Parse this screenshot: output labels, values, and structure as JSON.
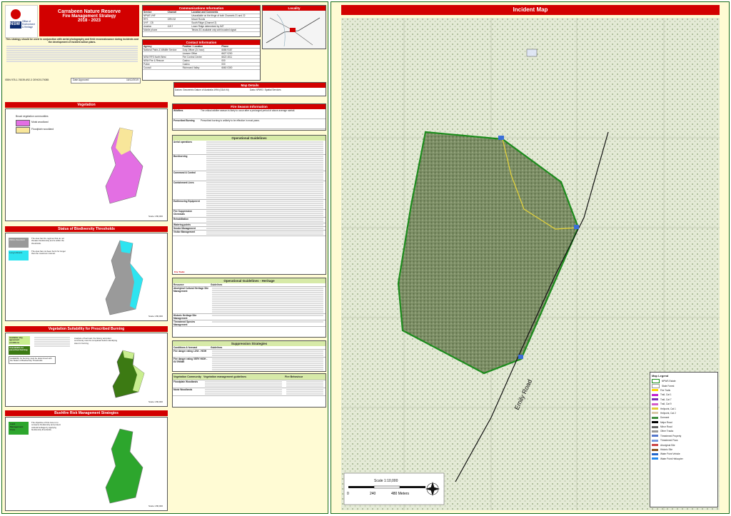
{
  "header": {
    "title": "Carrabeen Nature Reserve",
    "subtitle": "Fire Management Strategy",
    "years": "2018 - 2023",
    "logo_text": "Office of Environment & Heritage",
    "nsw": "NSW",
    "intro": "This strategy should be used in conjunction with aerial photography and field reconnaissance during incidents and the development of incident action plans.",
    "isbn": "ISBN 978-1-76039-692-3 OEH20170085",
    "date_label": "Date Approved",
    "date_value": "16/12/2019"
  },
  "communications": {
    "title": "Communications Information",
    "cols": [
      "Service",
      "Channel",
      "Location and Comments"
    ],
    "rows": [
      [
        "NPWS VHF",
        "",
        "Unavailable on the fringe of both Channels 21 and 22"
      ],
      [
        "RFS",
        "GRN 52",
        "Mount Runds"
      ],
      [
        "UHF - CB",
        "",
        "South Ridge (Channel 2)"
      ],
      [
        "Aviation",
        "119.7",
        "Lower Ridge determined by IMT"
      ],
      [
        "Mobile phone",
        "",
        "Telstra 3G available only with boosted signal"
      ]
    ]
  },
  "locality": {
    "title": "Locality"
  },
  "contacts": {
    "title": "Contact Information",
    "cols": [
      "Agency",
      "Position / Location",
      "Phone"
    ],
    "rows": [
      [
        "National Parks & Wildlife Service",
        "Duty Officer (24 hour)",
        "6686 9187"
      ],
      [
        "",
        "Lismore Office",
        "6627 0200"
      ],
      [
        "NSW RFS North West",
        "Fire Control Centre",
        "6622 4011"
      ],
      [
        "NSW Fire & Rescue",
        "Casino",
        "000"
      ],
      [
        "Police",
        "Casino",
        "000"
      ],
      [
        "Council",
        "Richmond Valley",
        "6660 0300"
      ]
    ]
  },
  "map_details": {
    "title": "Map Details",
    "left": "Datum: Geocentric Datum of Australia 1994 (GDA 94)",
    "right": "Data: NPWS / Spatial Services"
  },
  "vegetation": {
    "title": "Vegetation",
    "legend_title": "Broad vegetation communities",
    "items": [
      {
        "label": "Moist woodland",
        "color": "#e36fe3"
      },
      {
        "label": "Floodplain woodland",
        "color": "#f8e69a"
      }
    ],
    "scale": "Scale 1:80,000"
  },
  "biodiversity": {
    "title": "Status of Biodiversity Thresholds",
    "items": [
      {
        "label": "Within threshold",
        "color": "#9a9a9a",
        "desc": "The area has fire regimes that do not threaten biodiversity and is within the thresholds."
      },
      {
        "label": "Long Unburnt",
        "color": "#2ee4f0",
        "desc": "The area has not been burnt for longer than the maximum interval."
      }
    ],
    "scale": "Scale 1:80,000"
  },
  "suitability": {
    "title": "Vegetation Suitability for Prescribed Burning",
    "items": [
      {
        "label": "Available only, agreement conditions",
        "color": "#c9ee8f"
      },
      {
        "label": "Unavailable for prescribed burning",
        "color": "#3c7a13"
      },
      {
        "label": "Availability for burning must be determined with the Status of Biodiversity Thresholds",
        "color": "#ffffff"
      }
    ],
    "note": "Analysis of fuel load, fire history and plant community must be completed before identifying sites for burning.",
    "scale": "Scale 1:80,000"
  },
  "bushfire_risk": {
    "title": "Bushfire Risk Management Strategies",
    "item_label": "Land Management Zone",
    "item_color": "#2da62d",
    "desc": "The objective of this zone is to conserve biodiversity and protect cultural heritage by applying biodiversity thresholds.",
    "scale": "Scale 1:80,000"
  },
  "fire_season": {
    "title": "Fire Season Information",
    "rows": [
      {
        "label": "Wildfires",
        "text": "The critical wildfire season is likely to occur after a prolonged period of above average rainfall."
      },
      {
        "label": "Prescribed Burning",
        "text": "Prescribed burning is unlikely to be effective in most years."
      }
    ]
  },
  "operational": {
    "title": "Operational Guidelines",
    "rows": [
      {
        "label": "Aerial operations",
        "lines": 6
      },
      {
        "label": "Backburning",
        "lines": 7
      },
      {
        "label": "Command & Control",
        "lines": 4
      },
      {
        "label": "Containment Lines",
        "lines": 8
      },
      {
        "label": "Earthmoving Equipment",
        "lines": 4
      },
      {
        "label": "Fire Suppression Chemicals",
        "lines": 3
      },
      {
        "label": "Rehabilitation",
        "lines": 2
      },
      {
        "label": "Watering points",
        "lines": 1
      },
      {
        "label": "Smoke Management",
        "lines": 1
      },
      {
        "label": "Visitor Management",
        "lines": 2
      }
    ],
    "footer_label": "Fire Trails:"
  },
  "heritage": {
    "title": "Operational Guidelines - Heritage",
    "cols": [
      "Resource",
      "Guidelines"
    ],
    "rows": [
      {
        "label": "Aboriginal Cultural Heritage Site Management",
        "lines": 12
      },
      {
        "label": "Historic Heritage Site Management",
        "lines": 1
      },
      {
        "label": "Threatened Species Management",
        "lines": 1
      }
    ]
  },
  "suppression": {
    "title": "Suppression Strategies",
    "cols": [
      "Conditions & forecast",
      "Guidelines"
    ],
    "rows": [
      {
        "label": "Fire danger rating LOW - HIGH",
        "lines": 3
      },
      {
        "label": "Fire danger rating VERY HIGH - EXTREME",
        "lines": 6
      },
      {
        "label": "Catastrophic",
        "lines": 1
      }
    ]
  },
  "veg_management": {
    "cols": [
      "Vegetation Community",
      "Vegetation management guidelines",
      "Fire Behaviour"
    ],
    "rows": [
      {
        "label": "Floodplain Woodlands",
        "lines": 3
      },
      {
        "label": "Moist Woodlands",
        "lines": 3
      }
    ]
  },
  "incident_map": {
    "title": "Incident Map",
    "road_label": "Emily Road",
    "scale_text": "Scale 1:10,000",
    "scale_ticks": [
      "0",
      "240",
      "480 Meters"
    ],
    "legend": {
      "title": "Map Legend",
      "items": [
        {
          "label": "NPWS Estate",
          "color": "#ffffff",
          "border": "#1a8c1a"
        },
        {
          "label": "State Forest",
          "color": "#ffffff",
          "border": "#999999"
        },
        {
          "label": "Fire Trails",
          "color": "#ffd500"
        },
        {
          "label": "Trail, Cat 1",
          "color": "#c21ccf"
        },
        {
          "label": "Trail, Cat 7",
          "color": "#7a2db8"
        },
        {
          "label": "Trail, Cat 9",
          "color": "#d45cc9"
        },
        {
          "label": "Helipoint, Cat 1",
          "color": "#e2cc36"
        },
        {
          "label": "Helipoint, Cat 2",
          "color": "#d9c8a8"
        },
        {
          "label": "Dormant",
          "color": "#3d8c3d"
        },
        {
          "label": "Major Road",
          "color": "#000000"
        },
        {
          "label": "Minor Road",
          "color": "#666666"
        },
        {
          "label": "Other Tracks",
          "color": "#999999"
        },
        {
          "label": "Threatened Property",
          "color": "#5577cc"
        },
        {
          "label": "Threatened Flora",
          "color": "#7799dd"
        },
        {
          "label": "Aboriginal Site",
          "color": "#cc4444"
        },
        {
          "label": "Historic Site",
          "color": "#885522"
        },
        {
          "label": "Water Point Vehicle",
          "color": "#2266cc"
        },
        {
          "label": "Water Point Helicopter",
          "color": "#2288ee"
        }
      ]
    }
  }
}
